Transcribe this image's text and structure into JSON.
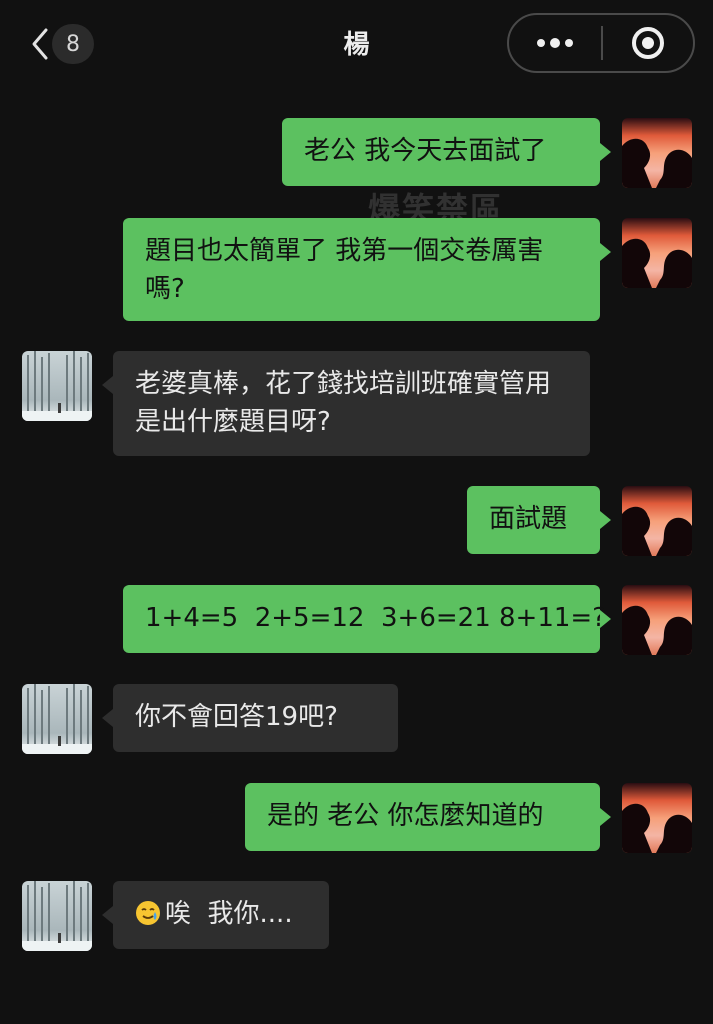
{
  "header": {
    "title": "楊",
    "unread_count": "8"
  },
  "watermark": "爆笑禁區",
  "messages": [
    {
      "side": "me",
      "text": "老公 我今天去面試了"
    },
    {
      "side": "me",
      "text": "題目也太簡單了 我第一個交卷厲害嗎?"
    },
    {
      "side": "them",
      "text": "老婆真棒，花了錢找培訓班確實管用 是出什麼題目呀?"
    },
    {
      "side": "me",
      "text": "面試題"
    },
    {
      "side": "me",
      "text": "1+4=5  2+5=12  3+6=21 8+11=?"
    },
    {
      "side": "them",
      "text": "你不會回答19吧?"
    },
    {
      "side": "me",
      "text": "是的 老公 你怎麼知道的"
    },
    {
      "side": "them",
      "emoji": "smiling-face-with-tear",
      "text": "唉  我你...."
    }
  ],
  "colors": {
    "background": "#111111",
    "bubble_me": "#5cc160",
    "bubble_them": "#2e2e2e"
  }
}
